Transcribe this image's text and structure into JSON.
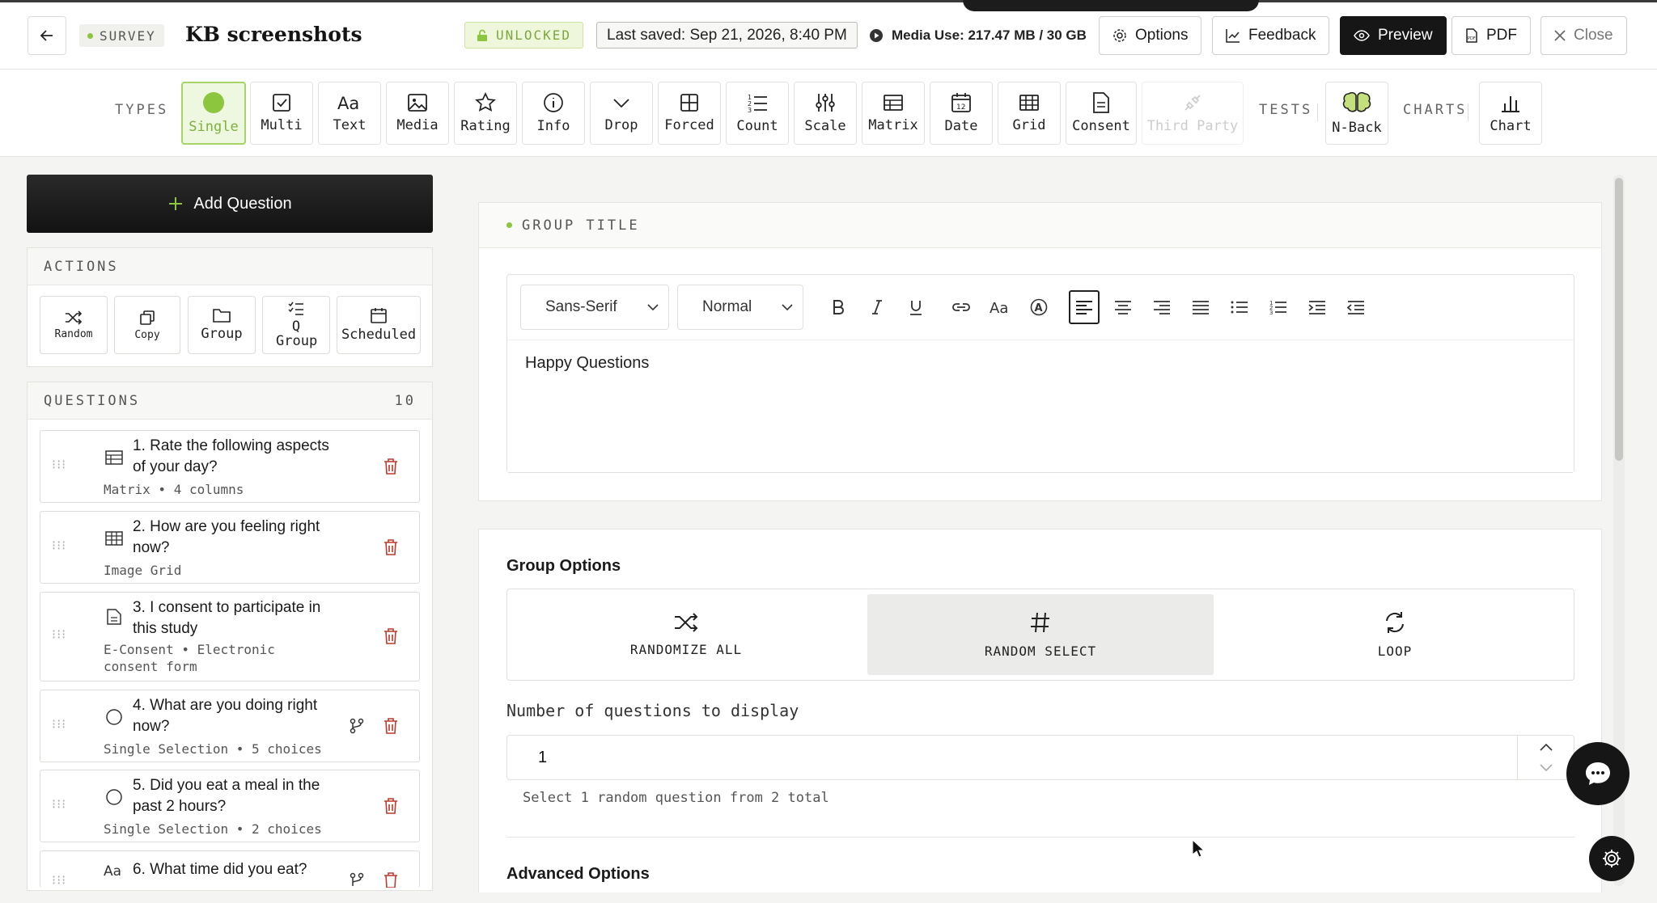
{
  "header": {
    "badge": "SURVEY",
    "title": "KB screenshots",
    "lock_status": "UNLOCKED",
    "last_saved": "Last saved: Sep 21, 2026, 8:40 PM",
    "media_use": "Media Use: 217.47 MB / 30 GB",
    "buttons": {
      "options": "Options",
      "feedback": "Feedback",
      "preview": "Preview",
      "pdf": "PDF",
      "close": "Close"
    }
  },
  "toolbar": {
    "types_label": "TYPES",
    "tests_label": "TESTS",
    "charts_label": "CHARTS",
    "types": [
      "Single",
      "Multi",
      "Text",
      "Media",
      "Rating",
      "Info",
      "Drop",
      "Forced",
      "Count",
      "Scale",
      "Matrix",
      "Date",
      "Grid",
      "Consent",
      "Third Party"
    ],
    "tests": [
      "N-Back"
    ],
    "charts": [
      "Chart"
    ],
    "active_type": "Single",
    "date_icon_number": "12"
  },
  "sidebar": {
    "add_question": "Add Question",
    "actions_label": "ACTIONS",
    "actions": [
      "Random",
      "Copy",
      "Group",
      "Q Group",
      "Scheduled"
    ],
    "questions_label": "QUESTIONS",
    "questions_count": "10",
    "questions": [
      {
        "title": "1. Rate the following aspects of your day?",
        "meta": "Matrix • 4 columns"
      },
      {
        "title": "2. How are you feeling right now?",
        "meta": "Image Grid"
      },
      {
        "title": "3. I consent to participate in this study",
        "meta": "E-Consent • Electronic consent form"
      },
      {
        "title": "4. What are you doing right now?",
        "meta": "Single Selection • 5 choices"
      },
      {
        "title": "5. Did you eat a meal in the past 2 hours?",
        "meta": "Single Selection • 2 choices"
      },
      {
        "title": "6. What time did you eat?",
        "meta": ""
      }
    ]
  },
  "main": {
    "group_title_label": "GROUP TITLE",
    "editor": {
      "font": "Sans-Serif",
      "size": "Normal",
      "content": "Happy Questions"
    },
    "group_options": {
      "title": "Group Options",
      "modes": [
        "RANDOMIZE ALL",
        "RANDOM SELECT",
        "LOOP"
      ],
      "selected_mode": "RANDOM SELECT",
      "count_label": "Number of questions to display",
      "count_value": "1",
      "help": "Select 1 random question from 2 total"
    },
    "advanced_title": "Advanced Options"
  },
  "colors": {
    "accent_green": "#8cc63f",
    "dark": "#161616",
    "danger": "#c0392b"
  }
}
